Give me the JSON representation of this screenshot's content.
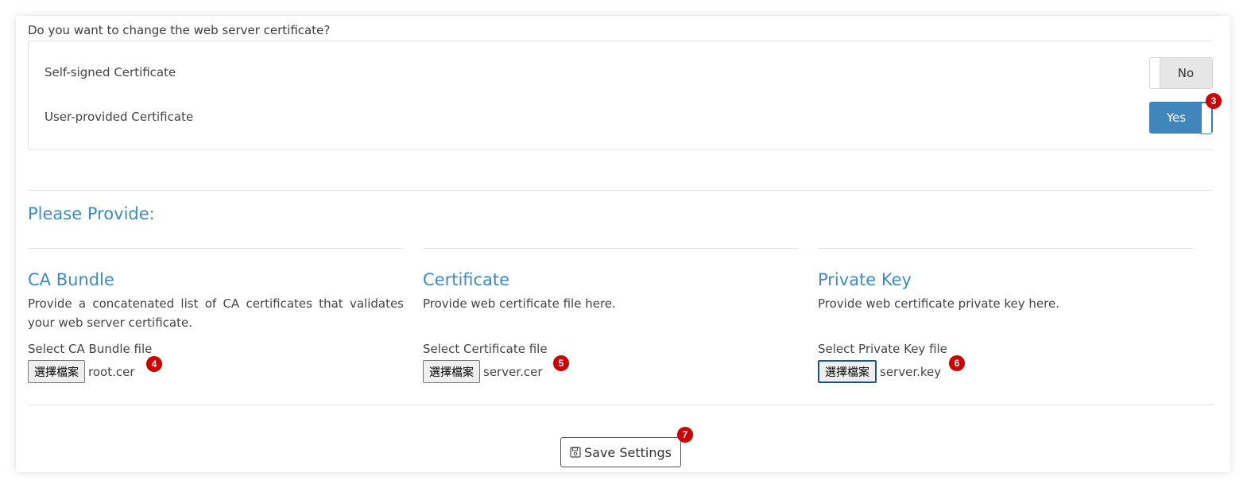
{
  "question": "Do you want to change the web server certificate?",
  "options": [
    {
      "label": "Self-signed Certificate",
      "toggle": "No"
    },
    {
      "label": "User-provided Certificate",
      "toggle": "Yes"
    }
  ],
  "section_title": "Please Provide:",
  "columns": [
    {
      "title": "CA Bundle",
      "description": "Provide a concatenated list of CA certificates that validates your web server certificate.",
      "select_label": "Select CA Bundle file",
      "button_label": "選擇檔案",
      "file_name": "root.cer",
      "badge": "4"
    },
    {
      "title": "Certificate",
      "description": "Provide web certificate file here.",
      "select_label": "Select Certificate file",
      "button_label": "選擇檔案",
      "file_name": "server.cer",
      "badge": "5"
    },
    {
      "title": "Private Key",
      "description": "Provide web certificate private key here.",
      "select_label": "Select Private Key file",
      "button_label": "選擇檔案",
      "file_name": "server.key",
      "badge": "6"
    }
  ],
  "toggle_badge": "3",
  "save_button": {
    "label": "Save Settings",
    "icon": "floppy-disk-icon",
    "badge": "7"
  },
  "colors": {
    "accent": "#3e8bc4",
    "toggle_on": "#3f86bd",
    "badge": "#cc0000"
  }
}
